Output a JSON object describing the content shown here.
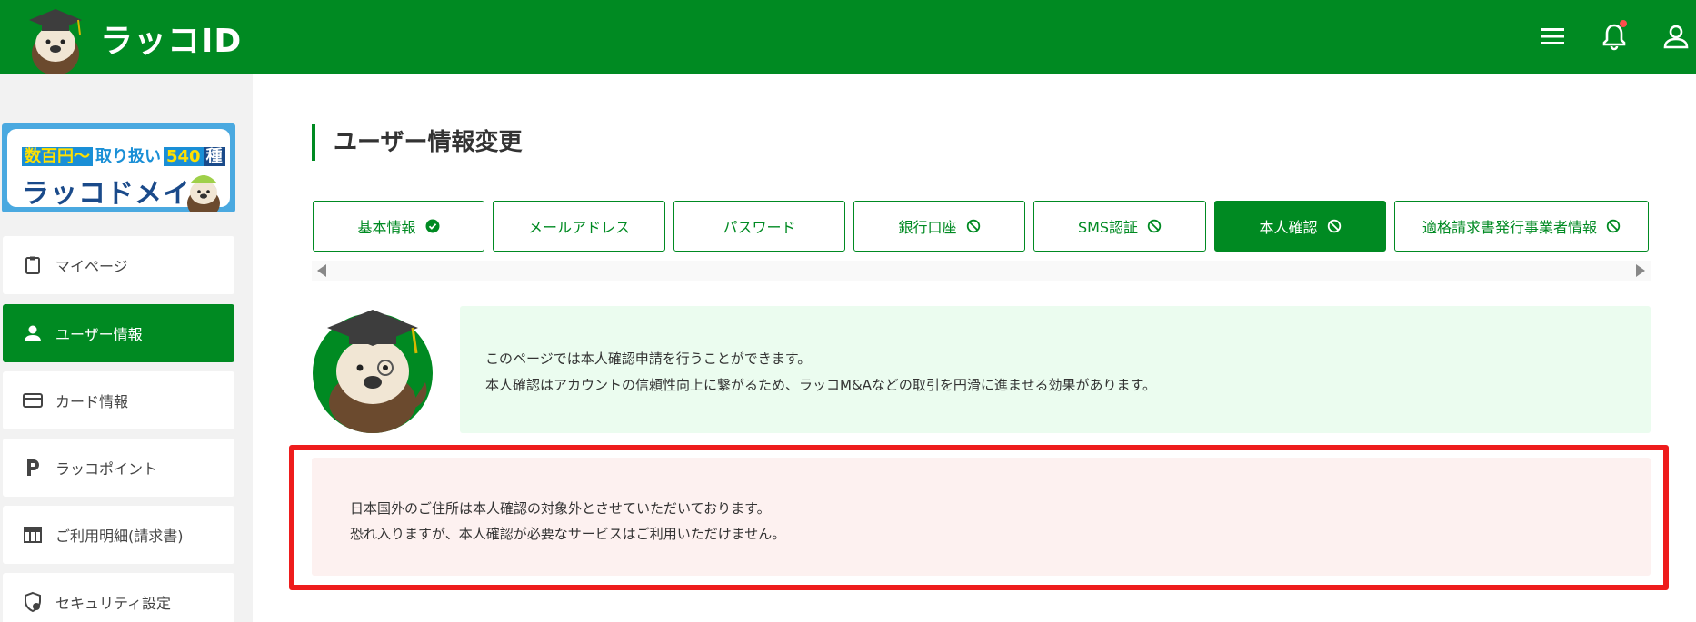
{
  "header": {
    "brand": "ラッコID",
    "icons": [
      "menu-icon",
      "bell-icon",
      "user-icon"
    ],
    "bg_color": "#008a22",
    "notification_dot_color": "#ff4d4d"
  },
  "sidebar": {
    "banner": {
      "line1_highlight": "数百円〜",
      "line1_mid": "取り扱い",
      "line1_count": "540",
      "line1_suffix": "種",
      "line2": "ラッコドメイン"
    },
    "items": [
      {
        "label": "マイページ",
        "icon": "clipboard-icon"
      },
      {
        "label": "ユーザー情報",
        "icon": "person-icon",
        "active": true
      },
      {
        "label": "カード情報",
        "icon": "credit-card-icon"
      },
      {
        "label": "ラッコポイント",
        "icon": "point-p-icon"
      },
      {
        "label": "ご利用明細(請求書)",
        "icon": "table-icon"
      },
      {
        "label": "セキュリティ設定",
        "icon": "shield-icon"
      }
    ]
  },
  "main": {
    "title": "ユーザー情報変更",
    "tabs": [
      {
        "label": "基本情報",
        "status_icon": "check-circle-icon"
      },
      {
        "label": "メールアドレス",
        "status_icon": ""
      },
      {
        "label": "パスワード",
        "status_icon": ""
      },
      {
        "label": "銀行口座",
        "status_icon": "prohibited-icon"
      },
      {
        "label": "SMS認証",
        "status_icon": "prohibited-icon"
      },
      {
        "label": "本人確認",
        "status_icon": "prohibited-icon",
        "active": true
      },
      {
        "label": "適格請求書発行事業者情報",
        "status_icon": "prohibited-icon"
      }
    ],
    "info": {
      "line1": "このページでは本人確認申請を行うことができます。",
      "line2": "本人確認はアカウントの信頼性向上に繋がるため、ラッコM&Aなどの取引を円滑に進ませる効果があります。"
    },
    "warning": {
      "line1": "日本国外のご住所は本人確認の対象外とさせていただいております。",
      "line2": "恐れ入りますが、本人確認が必要なサービスはご利用いただけません。"
    }
  },
  "colors": {
    "accent": "#008a22",
    "info_bg": "#ebfcef",
    "warning_bg": "#fdf1f0",
    "highlight_frame": "#ee1c1c"
  }
}
